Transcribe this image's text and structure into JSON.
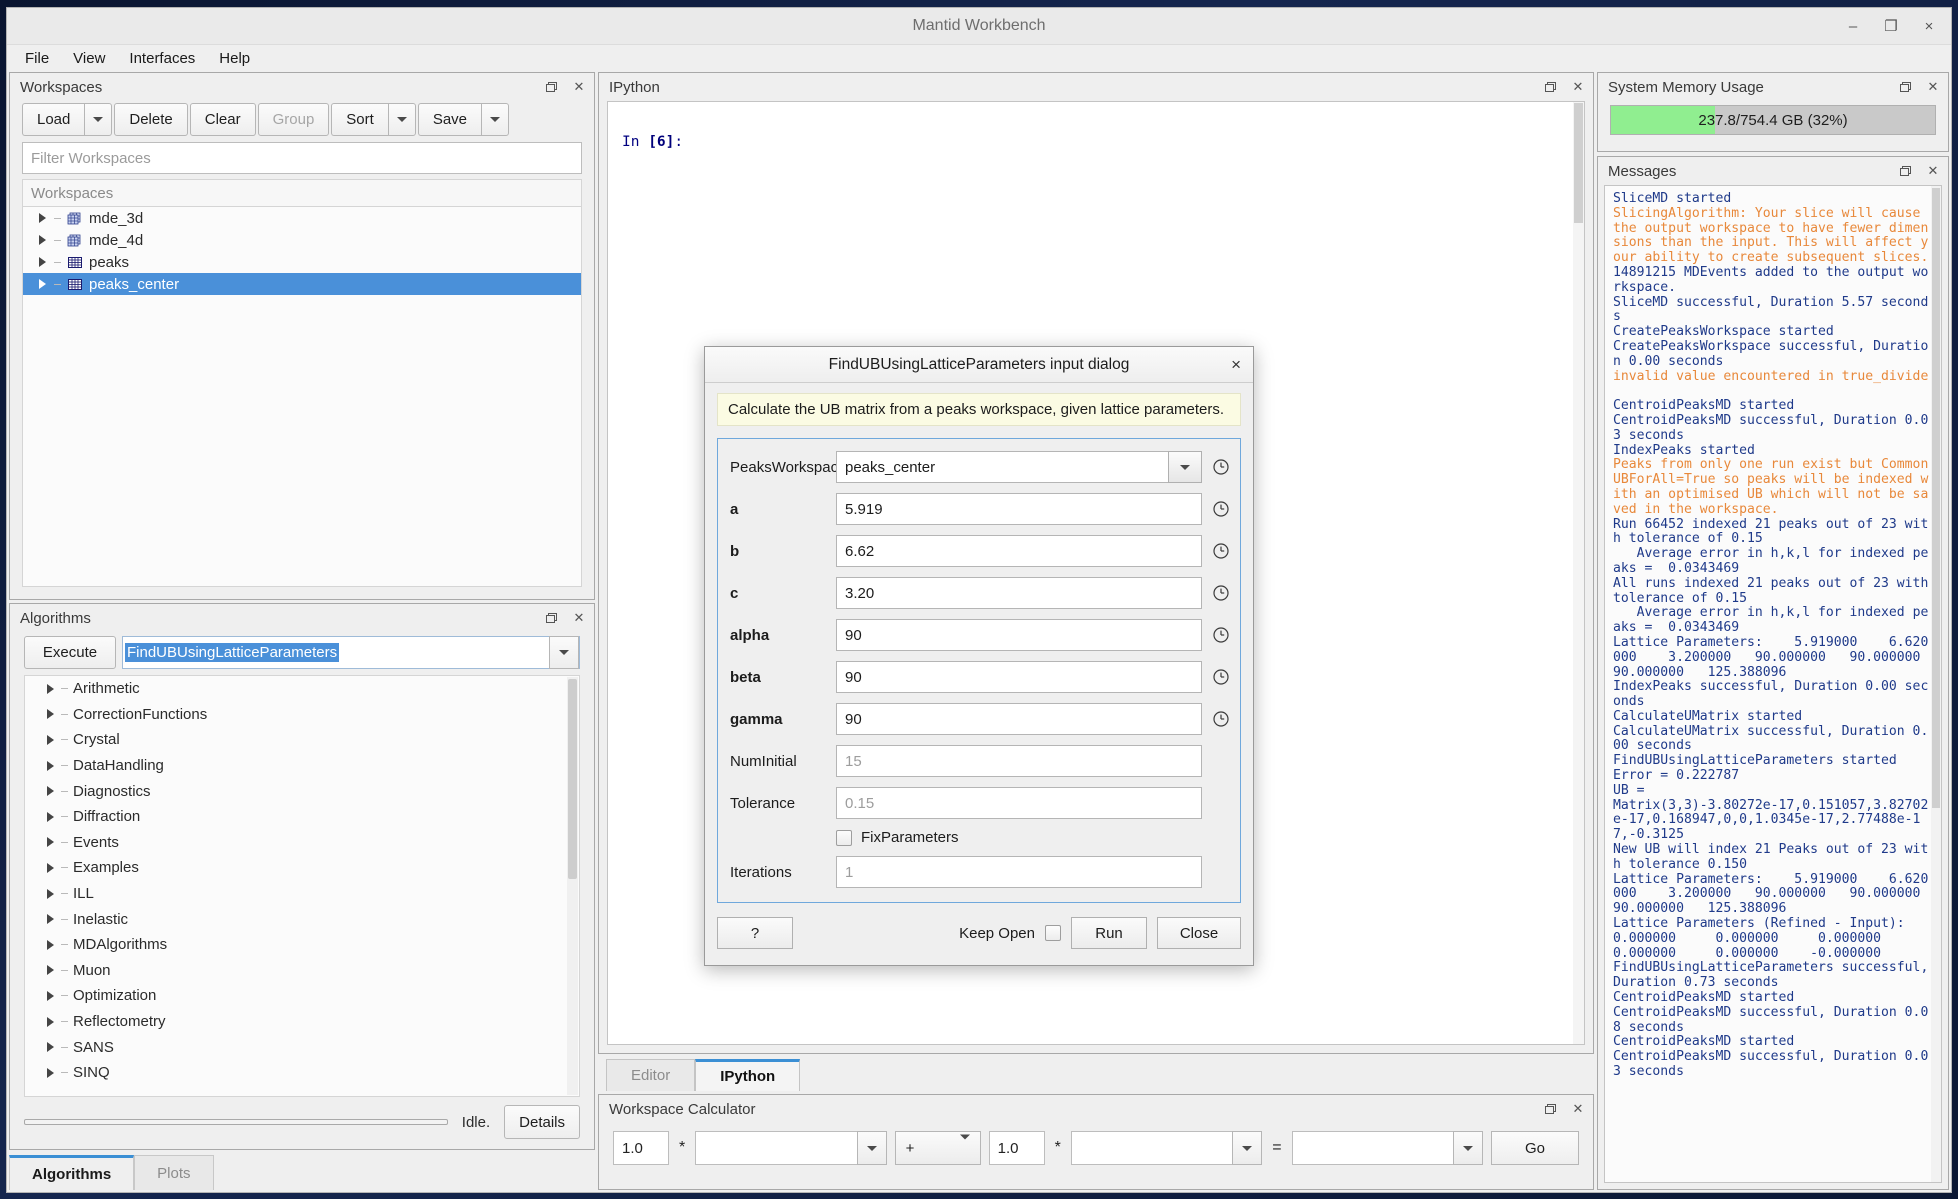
{
  "window": {
    "title": "Mantid Workbench",
    "minimize": "–",
    "maximize": "❐",
    "close": "×"
  },
  "menubar": {
    "items": [
      "File",
      "View",
      "Interfaces",
      "Help"
    ]
  },
  "workspaces_panel": {
    "title": "Workspaces",
    "toolbar": {
      "load": "Load",
      "delete": "Delete",
      "clear": "Clear",
      "group": "Group",
      "sort": "Sort",
      "save": "Save"
    },
    "filter_placeholder": "Filter Workspaces",
    "column_header": "Workspaces",
    "items": [
      {
        "name": "mde_3d",
        "icon": "md-workspace-icon",
        "selected": false
      },
      {
        "name": "mde_4d",
        "icon": "md-workspace-icon",
        "selected": false
      },
      {
        "name": "peaks",
        "icon": "table-workspace-icon",
        "selected": false
      },
      {
        "name": "peaks_center",
        "icon": "table-workspace-icon",
        "selected": true
      }
    ]
  },
  "algorithms_panel": {
    "title": "Algorithms",
    "execute_label": "Execute",
    "search_value": "FindUBUsingLatticeParameters",
    "categories": [
      "Arithmetic",
      "CorrectionFunctions",
      "Crystal",
      "DataHandling",
      "Diagnostics",
      "Diffraction",
      "Events",
      "Examples",
      "ILL",
      "Inelastic",
      "MDAlgorithms",
      "Muon",
      "Optimization",
      "Reflectometry",
      "SANS",
      "SINQ"
    ],
    "status": "Idle.",
    "details_label": "Details"
  },
  "bottom_tabs": {
    "tabs": [
      {
        "label": "Algorithms",
        "active": true
      },
      {
        "label": "Plots",
        "active": false
      }
    ]
  },
  "ipython_panel": {
    "title": "IPython",
    "prompt_prefix": "In ",
    "prompt_number": "[6]",
    "prompt_suffix": ":"
  },
  "editor_tabs": {
    "tabs": [
      {
        "label": "Editor",
        "active": false
      },
      {
        "label": "IPython",
        "active": true
      }
    ]
  },
  "workspace_calculator": {
    "title": "Workspace Calculator",
    "scale1": "1.0",
    "operand_star1": "*",
    "lhs_workspace": "",
    "operator": "+",
    "scale2": "1.0",
    "operand_star2": "*",
    "rhs_workspace": "",
    "equals": "=",
    "output_workspace": "",
    "go_label": "Go"
  },
  "memory_panel": {
    "title": "System Memory Usage",
    "usage_text": "237.8/754.4 GB (32%)",
    "percent": 32,
    "fill_color": "#90ee90"
  },
  "messages_panel": {
    "title": "Messages",
    "lines": [
      {
        "text": "SliceMD started",
        "level": "normal"
      },
      {
        "text": "SlicingAlgorithm: Your slice will cause the output workspace to have fewer dimensions than the input. This will affect your ability to create subsequent slices.",
        "level": "warn"
      },
      {
        "text": "14891215 MDEvents added to the output workspace.",
        "level": "normal"
      },
      {
        "text": "SliceMD successful, Duration 5.57 seconds",
        "level": "normal"
      },
      {
        "text": "CreatePeaksWorkspace started",
        "level": "normal"
      },
      {
        "text": "CreatePeaksWorkspace successful, Duration 0.00 seconds",
        "level": "normal"
      },
      {
        "text": "invalid value encountered in true_divide",
        "level": "warn"
      },
      {
        "text": "",
        "level": "normal"
      },
      {
        "text": "CentroidPeaksMD started",
        "level": "normal"
      },
      {
        "text": "CentroidPeaksMD successful, Duration 0.03 seconds",
        "level": "normal"
      },
      {
        "text": "IndexPeaks started",
        "level": "normal"
      },
      {
        "text": "Peaks from only one run exist but CommonUBForAll=True so peaks will be indexed with an optimised UB which will not be saved in the workspace.",
        "level": "warn"
      },
      {
        "text": "Run 66452 indexed 21 peaks out of 23 with tolerance of 0.15",
        "level": "normal"
      },
      {
        "text": "   Average error in h,k,l for indexed peaks =  0.0343469",
        "level": "normal"
      },
      {
        "text": "All runs indexed 21 peaks out of 23 with tolerance of 0.15",
        "level": "normal"
      },
      {
        "text": "   Average error in h,k,l for indexed peaks =  0.0343469",
        "level": "normal"
      },
      {
        "text": "Lattice Parameters:    5.919000    6.620000    3.200000   90.000000   90.000000   90.000000   125.388096",
        "level": "normal"
      },
      {
        "text": "IndexPeaks successful, Duration 0.00 seconds",
        "level": "normal"
      },
      {
        "text": "CalculateUMatrix started",
        "level": "normal"
      },
      {
        "text": "CalculateUMatrix successful, Duration 0.00 seconds",
        "level": "normal"
      },
      {
        "text": "FindUBUsingLatticeParameters started",
        "level": "normal"
      },
      {
        "text": "Error = 0.222787",
        "level": "normal"
      },
      {
        "text": "UB = ",
        "level": "normal"
      },
      {
        "text": "Matrix(3,3)-3.80272e-17,0.151057,3.82702e-17,0.168947,0,0,1.0345e-17,2.77488e-17,-0.3125",
        "level": "normal"
      },
      {
        "text": "New UB will index 21 Peaks out of 23 with tolerance 0.150",
        "level": "normal"
      },
      {
        "text": "Lattice Parameters:    5.919000    6.620000    3.200000   90.000000   90.000000   90.000000   125.388096",
        "level": "normal"
      },
      {
        "text": "Lattice Parameters (Refined - Input):",
        "level": "normal"
      },
      {
        "text": "0.000000     0.000000     0.000000     0.000000     0.000000    -0.000000",
        "level": "normal"
      },
      {
        "text": "FindUBUsingLatticeParameters successful, Duration 0.73 seconds",
        "level": "normal"
      },
      {
        "text": "CentroidPeaksMD started",
        "level": "normal"
      },
      {
        "text": "CentroidPeaksMD successful, Duration 0.08 seconds",
        "level": "normal"
      },
      {
        "text": "CentroidPeaksMD started",
        "level": "normal"
      },
      {
        "text": "CentroidPeaksMD successful, Duration 0.03 seconds",
        "level": "normal"
      }
    ]
  },
  "dialog": {
    "title": "FindUBUsingLatticeParameters input dialog",
    "close_glyph": "×",
    "description": "Calculate the UB matrix from a peaks workspace, given lattice parameters.",
    "fields": [
      {
        "label": "PeaksWorkspace",
        "value": "peaks_center",
        "type": "combo",
        "bold": false,
        "placeholder": false
      },
      {
        "label": "a",
        "value": "5.919",
        "type": "text",
        "bold": true,
        "placeholder": false
      },
      {
        "label": "b",
        "value": "6.62",
        "type": "text",
        "bold": true,
        "placeholder": false
      },
      {
        "label": "c",
        "value": "3.20",
        "type": "text",
        "bold": true,
        "placeholder": false
      },
      {
        "label": "alpha",
        "value": "90",
        "type": "text",
        "bold": true,
        "placeholder": false
      },
      {
        "label": "beta",
        "value": "90",
        "type": "text",
        "bold": true,
        "placeholder": false
      },
      {
        "label": "gamma",
        "value": "90",
        "type": "text",
        "bold": true,
        "placeholder": false
      },
      {
        "label": "NumInitial",
        "value": "15",
        "type": "text",
        "bold": false,
        "placeholder": true
      },
      {
        "label": "Tolerance",
        "value": "0.15",
        "type": "text",
        "bold": false,
        "placeholder": true
      }
    ],
    "fix_parameters_label": "FixParameters",
    "fix_parameters_checked": false,
    "iterations_label": "Iterations",
    "iterations_value": "1",
    "help_label": "?",
    "keep_open_label": "Keep Open",
    "keep_open_checked": false,
    "run_label": "Run",
    "close_label": "Close"
  }
}
